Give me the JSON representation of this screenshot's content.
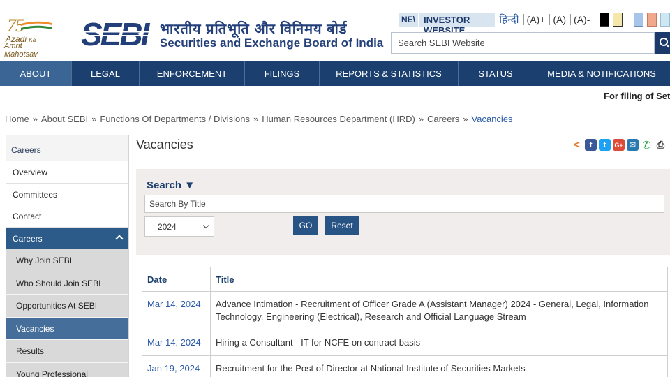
{
  "header": {
    "azadi": {
      "number": "75",
      "line1": "Azadi",
      "line1_small": "Ka",
      "line2": "Amrit Mahotsav"
    },
    "title_hindi": "भारतीय प्रतिभूति और विनिमय बोर्ड",
    "title_english": "Securities and Exchange Board of India",
    "new_badge": "NE\\",
    "investor_website": "INVESTOR WEBSITE",
    "hindi_link": "हिन्दी",
    "font_controls": [
      "(A)+",
      "(A)",
      "(A)-"
    ],
    "contrast_swatches": [
      "#000000",
      "#f5e7a9",
      "#a8c4e8",
      "#f0a98c",
      "#cfe6f3"
    ],
    "search_placeholder": "Search SEBI Website"
  },
  "nav": {
    "items": [
      "ABOUT",
      "LEGAL",
      "ENFORCEMENT",
      "FILINGS",
      "REPORTS & STATISTICS",
      "STATUS",
      "MEDIA & NOTIFICATIONS"
    ],
    "active": "ABOUT"
  },
  "ticker": "For filing of Settle",
  "breadcrumb": [
    "Home",
    "About SEBI",
    "Functions Of Departments / Divisions",
    "Human Resources Department (HRD)",
    "Careers",
    "Vacancies"
  ],
  "sidebar": {
    "heading": "Careers",
    "items": [
      "Overview",
      "Committees",
      "Contact"
    ],
    "parent": "Careers",
    "subitems": [
      "Why Join SEBI",
      "Who Should Join SEBI",
      "Opportunities At SEBI",
      "Vacancies",
      "Results",
      "Young Professional"
    ],
    "active_subitem": "Vacancies"
  },
  "main": {
    "title": "Vacancies",
    "share_icons": [
      "share-icon",
      "facebook-icon",
      "twitter-icon",
      "google-plus-icon",
      "email-icon",
      "whatsapp-icon",
      "print-icon"
    ],
    "search": {
      "label": "Search ▼",
      "title_placeholder": "Search By Title",
      "year": "2024",
      "go_label": "GO",
      "reset_label": "Reset"
    },
    "table": {
      "headers": [
        "Date",
        "Title"
      ],
      "rows": [
        {
          "date": "Mar 14, 2024",
          "title": "Advance Intimation - Recruitment of Officer Grade A (Assistant Manager) 2024 - General, Legal, Information Technology, Engineering (Electrical), Research and Official Language Stream"
        },
        {
          "date": "Mar 14, 2024",
          "title": "Hiring a Consultant - IT for NCFE on contract basis"
        },
        {
          "date": "Jan 19, 2024",
          "title": "Recruitment for the Post of Director at National Institute of Securities Markets"
        }
      ]
    }
  }
}
